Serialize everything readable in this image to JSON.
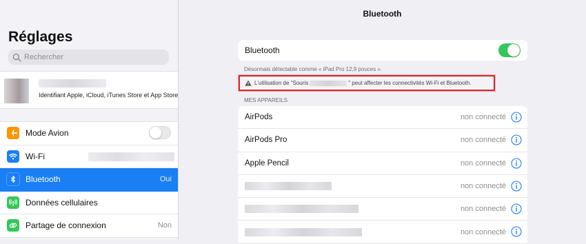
{
  "sidebar": {
    "title": "Réglages",
    "search_placeholder": "Rechercher",
    "account_subtitle": "Identifiant Apple, iCloud, iTunes Store et App Store",
    "items": [
      {
        "label": "Mode Avion",
        "icon": "airplane-icon",
        "color": "#ff9500",
        "value": ""
      },
      {
        "label": "Wi-Fi",
        "icon": "wifi-icon",
        "color": "#1a7ef5",
        "value": ""
      },
      {
        "label": "Bluetooth",
        "icon": "bluetooth-icon",
        "color": "#1a7ef5",
        "value": "Oui"
      },
      {
        "label": "Données cellulaires",
        "icon": "cellular-icon",
        "color": "#34c759",
        "value": ""
      },
      {
        "label": "Partage de connexion",
        "icon": "hotspot-icon",
        "color": "#34c759",
        "value": "Non"
      }
    ]
  },
  "detail": {
    "title": "Bluetooth",
    "bluetooth_row_label": "Bluetooth",
    "bluetooth_enabled": true,
    "discoverable_text": "Désormais détectable comme « iPad Pro 12,9 pouces ».",
    "warning_prefix": "L'utilisation de \"Souris",
    "warning_suffix": "\" peut affecter les connectivités Wi-Fi et Bluetooth.",
    "section_header": "MES APPAREILS",
    "devices": [
      {
        "name": "AirPods",
        "status": "non connecté"
      },
      {
        "name": "AirPods Pro",
        "status": "non connecté"
      },
      {
        "name": "Apple Pencil",
        "status": "non connecté"
      },
      {
        "name": "",
        "status": "non connecté"
      },
      {
        "name": "",
        "status": "non connecté"
      },
      {
        "name": "",
        "status": "non connecté"
      }
    ]
  },
  "colors": {
    "accent": "#1a7ef5",
    "toggle_on": "#34c759",
    "highlight_border": "#d6262b"
  }
}
